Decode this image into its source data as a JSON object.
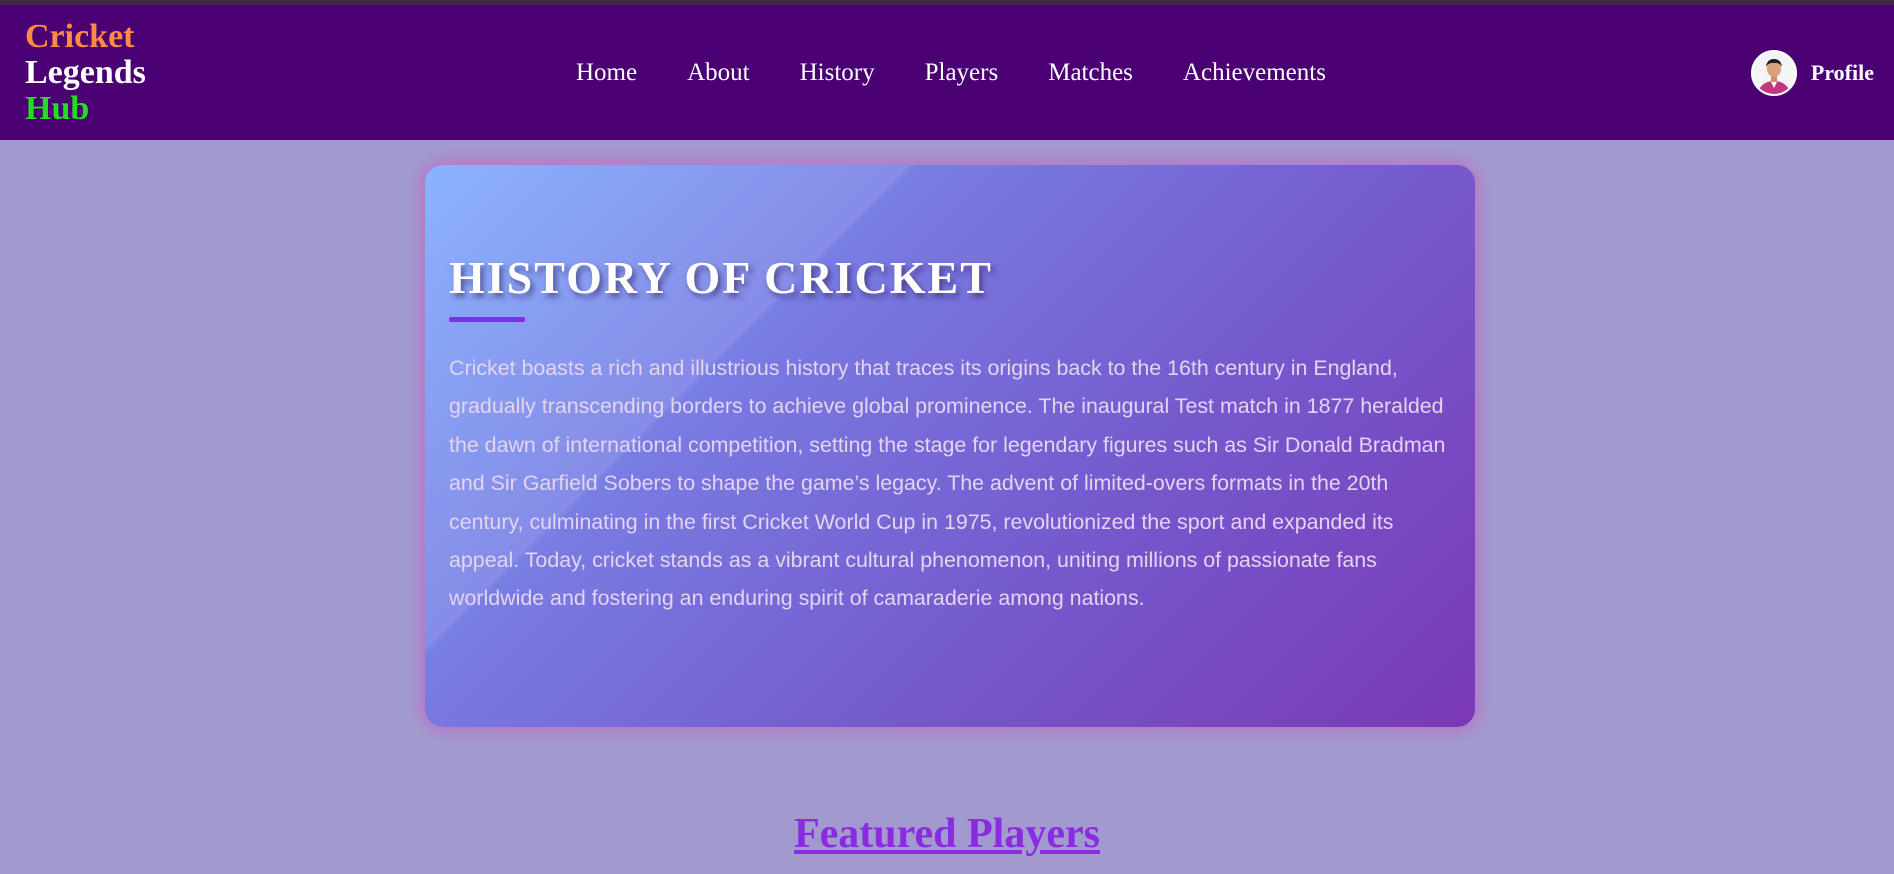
{
  "logo": {
    "line1": "Cricket",
    "line2": "Legends",
    "line3": "Hub",
    "colors": {
      "line1": "#ff8c42",
      "line2": "#ffffff",
      "line3": "#22dd22"
    }
  },
  "nav": {
    "items": [
      {
        "label": "Home"
      },
      {
        "label": "About"
      },
      {
        "label": "History"
      },
      {
        "label": "Players"
      },
      {
        "label": "Matches"
      },
      {
        "label": "Achievements"
      }
    ]
  },
  "profile": {
    "label": "Profile",
    "avatar_icon": "user-avatar-icon"
  },
  "history": {
    "title": "HISTORY OF CRICKET",
    "text": "Cricket boasts a rich and illustrious history that traces its origins back to the 16th century in England, gradually transcending borders to achieve global prominence. The inaugural Test match in 1877 heralded the dawn of international competition, setting the stage for legendary figures such as Sir Donald Bradman and Sir Garfield Sobers to shape the game’s legacy. The advent of limited-overs formats in the 20th century, culminating in the first Cricket World Cup in 1975, revolutionized the sport and expanded its appeal. Today, cricket stands as a vibrant cultural phenomenon, uniting millions of passionate fans worldwide and fostering an enduring spirit of camaraderie among nations."
  },
  "featured": {
    "heading": "Featured Players"
  },
  "colors": {
    "navbar": "#4a0072",
    "page_background": "#a29acf",
    "accent": "#8a2be2",
    "card_gradient_start": "#7aa8ff",
    "card_gradient_end": "#7a38b8"
  }
}
